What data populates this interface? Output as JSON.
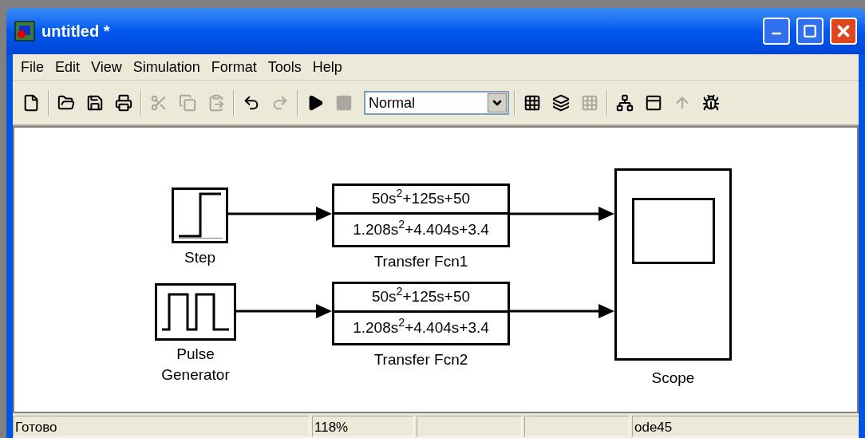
{
  "window": {
    "title": "untitled *"
  },
  "menu": [
    "File",
    "Edit",
    "View",
    "Simulation",
    "Format",
    "Tools",
    "Help"
  ],
  "toolbar": [
    [
      {
        "kind": "new",
        "disabled": false
      }
    ],
    [
      {
        "kind": "open",
        "disabled": false
      },
      {
        "kind": "save",
        "disabled": false
      },
      {
        "kind": "print",
        "disabled": false
      }
    ],
    [
      {
        "kind": "cut",
        "disabled": true
      },
      {
        "kind": "copy",
        "disabled": true
      },
      {
        "kind": "paste",
        "disabled": true
      }
    ],
    [
      {
        "kind": "undo",
        "disabled": false
      },
      {
        "kind": "redo",
        "disabled": true
      }
    ],
    [
      {
        "kind": "start",
        "disabled": false
      },
      {
        "kind": "stop",
        "disabled": true
      },
      {
        "kind": "mode",
        "value": "Normal"
      }
    ],
    [
      {
        "kind": "build",
        "disabled": false
      },
      {
        "kind": "update",
        "disabled": false
      },
      {
        "kind": "build",
        "disabled": true
      }
    ],
    [
      {
        "kind": "library",
        "disabled": false
      },
      {
        "kind": "explorer",
        "disabled": false
      },
      {
        "kind": "parent",
        "disabled": true
      },
      {
        "kind": "debug",
        "disabled": false
      }
    ]
  ],
  "blocks": [
    {
      "kind": "step",
      "label": "Step"
    },
    {
      "kind": "pulse",
      "label": "Pulse\nGenerator"
    },
    {
      "kind": "tf",
      "label": "Transfer Fcn1",
      "numerator": "50s$^{2}$+125s+50",
      "denominator": "1.208s$^{2}$+4.404s+3.4"
    },
    {
      "kind": "tf",
      "label": "Transfer Fcn2",
      "numerator": "50s$^{2}$+125s+50",
      "denominator": "1.208s$^{2}$+4.404s+3.4"
    },
    {
      "kind": "scope",
      "label": "Scope"
    }
  ],
  "status_bar": [
    {
      "kind": "text",
      "text": "Готово"
    },
    {
      "kind": "text",
      "text": "118%"
    },
    {
      "kind": "empty"
    },
    {
      "kind": "empty"
    },
    {
      "kind": "text",
      "text": "ode45"
    }
  ]
}
